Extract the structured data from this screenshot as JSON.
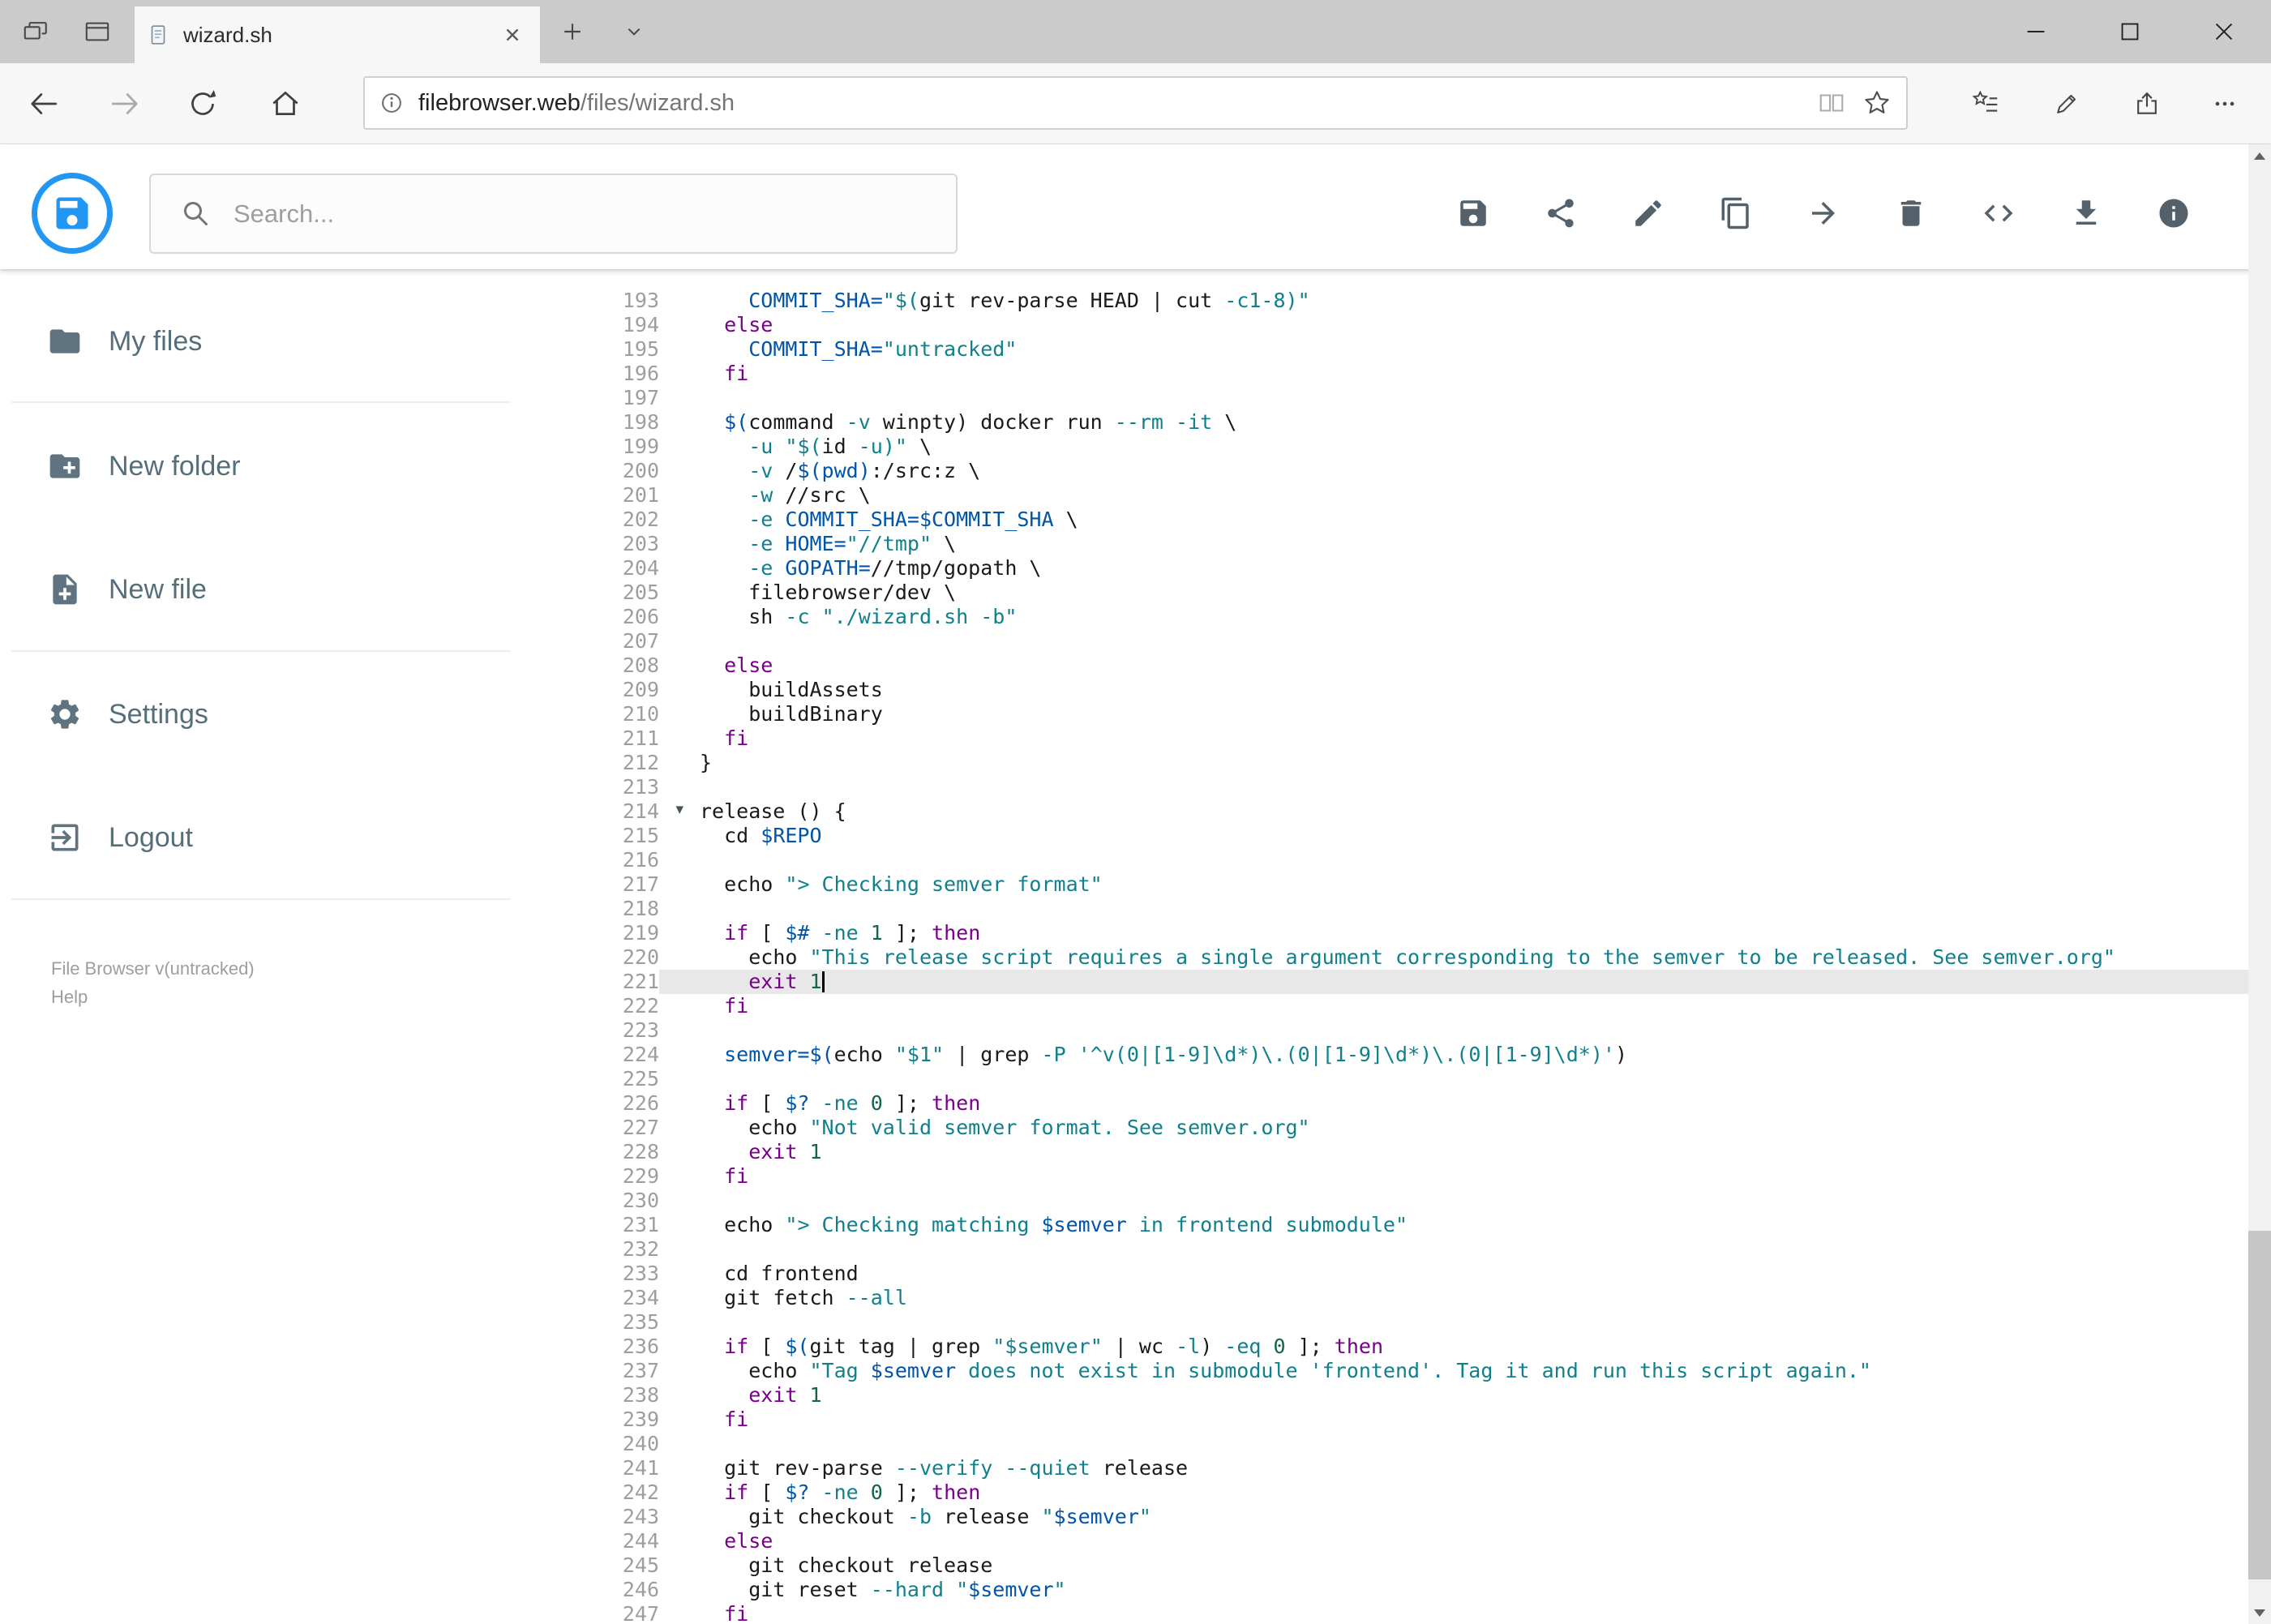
{
  "browser": {
    "tab_bar": {
      "tab_title": "wizard.sh"
    },
    "address_bar": {
      "domain": "filebrowser.web",
      "path": "/files/wizard.sh"
    },
    "icons": [
      "set-tabs-aside",
      "tab-preview",
      "page",
      "tab-close",
      "new-tab",
      "tab-list-chevron",
      "window-minimize",
      "window-maximize",
      "window-close",
      "back",
      "forward",
      "refresh",
      "home",
      "page-info",
      "reading-view",
      "favorite-star",
      "hub-favorites",
      "web-note-pen",
      "share",
      "more-options"
    ]
  },
  "app": {
    "search_placeholder": "Search...",
    "accent_color": "#2196f3",
    "toolbar_icons": [
      "save",
      "share",
      "edit",
      "copy",
      "move",
      "delete",
      "code",
      "download",
      "info"
    ],
    "sidebar": {
      "items": [
        {
          "label": "My files",
          "icon": "folder"
        },
        {
          "label": "New folder",
          "icon": "create-new-folder"
        },
        {
          "label": "New file",
          "icon": "new-file"
        },
        {
          "label": "Settings",
          "icon": "settings"
        },
        {
          "label": "Logout",
          "icon": "logout"
        }
      ],
      "footer_version": "File Browser v(untracked)",
      "footer_help": "Help"
    }
  },
  "editor": {
    "language": "shell",
    "first_line": 193,
    "last_line": 247,
    "active_line": 221,
    "cursor_line": 221,
    "cursor_col": 10,
    "fold_line": 214,
    "syntax_colors": {
      "plain": "#1a1a1a",
      "keyword": "#770088",
      "builtin": "#1a1a1a",
      "string": "#10808c",
      "variable": "#0055aa",
      "number": "#116644"
    },
    "lines": [
      {
        "n": 193,
        "seg": [
          [
            "p",
            "    "
          ],
          [
            "v",
            "COMMIT_SHA="
          ],
          [
            "s",
            "\"$("
          ],
          [
            "b",
            "git"
          ],
          [
            "p",
            " rev-parse HEAD | "
          ],
          [
            "b",
            "cut"
          ],
          [
            "p",
            " "
          ],
          [
            "s",
            "-c1-8)\""
          ]
        ]
      },
      {
        "n": 194,
        "seg": [
          [
            "p",
            "  "
          ],
          [
            "k",
            "else"
          ]
        ]
      },
      {
        "n": 195,
        "seg": [
          [
            "p",
            "    "
          ],
          [
            "v",
            "COMMIT_SHA="
          ],
          [
            "s",
            "\"untracked\""
          ]
        ]
      },
      {
        "n": 196,
        "seg": [
          [
            "p",
            "  "
          ],
          [
            "k",
            "fi"
          ]
        ]
      },
      {
        "n": 197,
        "seg": []
      },
      {
        "n": 198,
        "seg": [
          [
            "p",
            "  "
          ],
          [
            "v",
            "$("
          ],
          [
            "b",
            "command"
          ],
          [
            "p",
            " "
          ],
          [
            "s",
            "-v"
          ],
          [
            "p",
            " winpty) docker run "
          ],
          [
            "s",
            "--rm -it"
          ],
          [
            "p",
            " \\"
          ]
        ]
      },
      {
        "n": 199,
        "seg": [
          [
            "p",
            "    "
          ],
          [
            "s",
            "-u"
          ],
          [
            "p",
            " "
          ],
          [
            "s",
            "\"$("
          ],
          [
            "p",
            "id "
          ],
          [
            "s",
            "-u"
          ],
          [
            "s",
            ")\""
          ],
          [
            "p",
            " \\"
          ]
        ]
      },
      {
        "n": 200,
        "seg": [
          [
            "p",
            "    "
          ],
          [
            "s",
            "-v"
          ],
          [
            "p",
            " /"
          ],
          [
            "v",
            "$(pwd)"
          ],
          [
            "p",
            ":/src:z \\"
          ]
        ]
      },
      {
        "n": 201,
        "seg": [
          [
            "p",
            "    "
          ],
          [
            "s",
            "-w"
          ],
          [
            "p",
            " //src \\"
          ]
        ]
      },
      {
        "n": 202,
        "seg": [
          [
            "p",
            "    "
          ],
          [
            "s",
            "-e"
          ],
          [
            "p",
            " "
          ],
          [
            "v",
            "COMMIT_SHA=$COMMIT_SHA"
          ],
          [
            "p",
            " \\"
          ]
        ]
      },
      {
        "n": 203,
        "seg": [
          [
            "p",
            "    "
          ],
          [
            "s",
            "-e"
          ],
          [
            "p",
            " "
          ],
          [
            "v",
            "HOME="
          ],
          [
            "s",
            "\"//tmp\""
          ],
          [
            "p",
            " \\"
          ]
        ]
      },
      {
        "n": 204,
        "seg": [
          [
            "p",
            "    "
          ],
          [
            "s",
            "-e"
          ],
          [
            "p",
            " "
          ],
          [
            "v",
            "GOPATH="
          ],
          [
            "p",
            "//tmp/gopath \\"
          ]
        ]
      },
      {
        "n": 205,
        "seg": [
          [
            "p",
            "    filebrowser/dev \\"
          ]
        ]
      },
      {
        "n": 206,
        "seg": [
          [
            "p",
            "    "
          ],
          [
            "b",
            "sh"
          ],
          [
            "p",
            " "
          ],
          [
            "s",
            "-c"
          ],
          [
            "p",
            " "
          ],
          [
            "s",
            "\"./wizard.sh -b\""
          ]
        ]
      },
      {
        "n": 207,
        "seg": []
      },
      {
        "n": 208,
        "seg": [
          [
            "p",
            "  "
          ],
          [
            "k",
            "else"
          ]
        ]
      },
      {
        "n": 209,
        "seg": [
          [
            "p",
            "    buildAssets"
          ]
        ]
      },
      {
        "n": 210,
        "seg": [
          [
            "p",
            "    buildBinary"
          ]
        ]
      },
      {
        "n": 211,
        "seg": [
          [
            "p",
            "  "
          ],
          [
            "k",
            "fi"
          ]
        ]
      },
      {
        "n": 212,
        "seg": [
          [
            "p",
            "}"
          ]
        ]
      },
      {
        "n": 213,
        "seg": []
      },
      {
        "n": 214,
        "seg": [
          [
            "p",
            "release () {"
          ]
        ]
      },
      {
        "n": 215,
        "seg": [
          [
            "p",
            "  "
          ],
          [
            "b",
            "cd"
          ],
          [
            "p",
            " "
          ],
          [
            "v",
            "$REPO"
          ]
        ]
      },
      {
        "n": 216,
        "seg": []
      },
      {
        "n": 217,
        "seg": [
          [
            "p",
            "  "
          ],
          [
            "b",
            "echo"
          ],
          [
            "p",
            " "
          ],
          [
            "s",
            "\"> Checking semver format\""
          ]
        ]
      },
      {
        "n": 218,
        "seg": []
      },
      {
        "n": 219,
        "seg": [
          [
            "p",
            "  "
          ],
          [
            "k",
            "if"
          ],
          [
            "p",
            " [ "
          ],
          [
            "v",
            "$#"
          ],
          [
            "p",
            " "
          ],
          [
            "s",
            "-ne"
          ],
          [
            "p",
            " "
          ],
          [
            "n",
            "1"
          ],
          [
            "p",
            " ]; "
          ],
          [
            "k",
            "then"
          ]
        ]
      },
      {
        "n": 220,
        "seg": [
          [
            "p",
            "    "
          ],
          [
            "b",
            "echo"
          ],
          [
            "p",
            " "
          ],
          [
            "s",
            "\"This release script requires a single argument corresponding to the semver to be released. See semver.org\""
          ]
        ]
      },
      {
        "n": 221,
        "seg": [
          [
            "p",
            "    "
          ],
          [
            "k",
            "exit"
          ],
          [
            "p",
            " "
          ],
          [
            "n",
            "1"
          ]
        ]
      },
      {
        "n": 222,
        "seg": [
          [
            "p",
            "  "
          ],
          [
            "k",
            "fi"
          ]
        ]
      },
      {
        "n": 223,
        "seg": []
      },
      {
        "n": 224,
        "seg": [
          [
            "p",
            "  "
          ],
          [
            "v",
            "semver=$("
          ],
          [
            "b",
            "echo"
          ],
          [
            "p",
            " "
          ],
          [
            "s",
            "\"$1\""
          ],
          [
            "p",
            " | "
          ],
          [
            "b",
            "grep"
          ],
          [
            "p",
            " "
          ],
          [
            "s",
            "-P"
          ],
          [
            "p",
            " "
          ],
          [
            "s",
            "'^v(0|[1-9]\\d*)\\.(0|[1-9]\\d*)\\.(0|[1-9]\\d*)'"
          ],
          [
            "p",
            ")"
          ]
        ]
      },
      {
        "n": 225,
        "seg": []
      },
      {
        "n": 226,
        "seg": [
          [
            "p",
            "  "
          ],
          [
            "k",
            "if"
          ],
          [
            "p",
            " [ "
          ],
          [
            "v",
            "$?"
          ],
          [
            "p",
            " "
          ],
          [
            "s",
            "-ne"
          ],
          [
            "p",
            " "
          ],
          [
            "n",
            "0"
          ],
          [
            "p",
            " ]; "
          ],
          [
            "k",
            "then"
          ]
        ]
      },
      {
        "n": 227,
        "seg": [
          [
            "p",
            "    "
          ],
          [
            "b",
            "echo"
          ],
          [
            "p",
            " "
          ],
          [
            "s",
            "\"Not valid semver format. See semver.org\""
          ]
        ]
      },
      {
        "n": 228,
        "seg": [
          [
            "p",
            "    "
          ],
          [
            "k",
            "exit"
          ],
          [
            "p",
            " "
          ],
          [
            "n",
            "1"
          ]
        ]
      },
      {
        "n": 229,
        "seg": [
          [
            "p",
            "  "
          ],
          [
            "k",
            "fi"
          ]
        ]
      },
      {
        "n": 230,
        "seg": []
      },
      {
        "n": 231,
        "seg": [
          [
            "p",
            "  "
          ],
          [
            "b",
            "echo"
          ],
          [
            "p",
            " "
          ],
          [
            "s",
            "\"> Checking matching "
          ],
          [
            "v",
            "$semver"
          ],
          [
            "s",
            " in frontend submodule\""
          ]
        ]
      },
      {
        "n": 232,
        "seg": []
      },
      {
        "n": 233,
        "seg": [
          [
            "p",
            "  "
          ],
          [
            "b",
            "cd"
          ],
          [
            "p",
            " frontend"
          ]
        ]
      },
      {
        "n": 234,
        "seg": [
          [
            "p",
            "  "
          ],
          [
            "b",
            "git"
          ],
          [
            "p",
            " fetch "
          ],
          [
            "s",
            "--all"
          ]
        ]
      },
      {
        "n": 235,
        "seg": []
      },
      {
        "n": 236,
        "seg": [
          [
            "p",
            "  "
          ],
          [
            "k",
            "if"
          ],
          [
            "p",
            " [ "
          ],
          [
            "v",
            "$("
          ],
          [
            "b",
            "git"
          ],
          [
            "p",
            " tag | "
          ],
          [
            "b",
            "grep"
          ],
          [
            "p",
            " "
          ],
          [
            "s",
            "\"$semver\""
          ],
          [
            "p",
            " | "
          ],
          [
            "b",
            "wc"
          ],
          [
            "p",
            " "
          ],
          [
            "s",
            "-l"
          ],
          [
            "p",
            ") "
          ],
          [
            "s",
            "-eq"
          ],
          [
            "p",
            " "
          ],
          [
            "n",
            "0"
          ],
          [
            "p",
            " ]; "
          ],
          [
            "k",
            "then"
          ]
        ]
      },
      {
        "n": 237,
        "seg": [
          [
            "p",
            "    "
          ],
          [
            "b",
            "echo"
          ],
          [
            "p",
            " "
          ],
          [
            "s",
            "\"Tag "
          ],
          [
            "v",
            "$semver"
          ],
          [
            "s",
            " does not exist in submodule 'frontend'. Tag it and run this script again.\""
          ]
        ]
      },
      {
        "n": 238,
        "seg": [
          [
            "p",
            "    "
          ],
          [
            "k",
            "exit"
          ],
          [
            "p",
            " "
          ],
          [
            "n",
            "1"
          ]
        ]
      },
      {
        "n": 239,
        "seg": [
          [
            "p",
            "  "
          ],
          [
            "k",
            "fi"
          ]
        ]
      },
      {
        "n": 240,
        "seg": []
      },
      {
        "n": 241,
        "seg": [
          [
            "p",
            "  "
          ],
          [
            "b",
            "git"
          ],
          [
            "p",
            " rev-parse "
          ],
          [
            "s",
            "--verify --quiet"
          ],
          [
            "p",
            " release"
          ]
        ]
      },
      {
        "n": 242,
        "seg": [
          [
            "p",
            "  "
          ],
          [
            "k",
            "if"
          ],
          [
            "p",
            " [ "
          ],
          [
            "v",
            "$?"
          ],
          [
            "p",
            " "
          ],
          [
            "s",
            "-ne"
          ],
          [
            "p",
            " "
          ],
          [
            "n",
            "0"
          ],
          [
            "p",
            " ]; "
          ],
          [
            "k",
            "then"
          ]
        ]
      },
      {
        "n": 243,
        "seg": [
          [
            "p",
            "    "
          ],
          [
            "b",
            "git"
          ],
          [
            "p",
            " checkout "
          ],
          [
            "s",
            "-b"
          ],
          [
            "p",
            " release "
          ],
          [
            "s",
            "\""
          ],
          [
            "v",
            "$semver"
          ],
          [
            "s",
            "\""
          ]
        ]
      },
      {
        "n": 244,
        "seg": [
          [
            "p",
            "  "
          ],
          [
            "k",
            "else"
          ]
        ]
      },
      {
        "n": 245,
        "seg": [
          [
            "p",
            "    "
          ],
          [
            "b",
            "git"
          ],
          [
            "p",
            " checkout release"
          ]
        ]
      },
      {
        "n": 246,
        "seg": [
          [
            "p",
            "    "
          ],
          [
            "b",
            "git"
          ],
          [
            "p",
            " reset "
          ],
          [
            "s",
            "--hard"
          ],
          [
            "p",
            " "
          ],
          [
            "s",
            "\""
          ],
          [
            "v",
            "$semver"
          ],
          [
            "s",
            "\""
          ]
        ]
      },
      {
        "n": 247,
        "seg": [
          [
            "p",
            "  "
          ],
          [
            "k",
            "fi"
          ]
        ]
      }
    ]
  }
}
